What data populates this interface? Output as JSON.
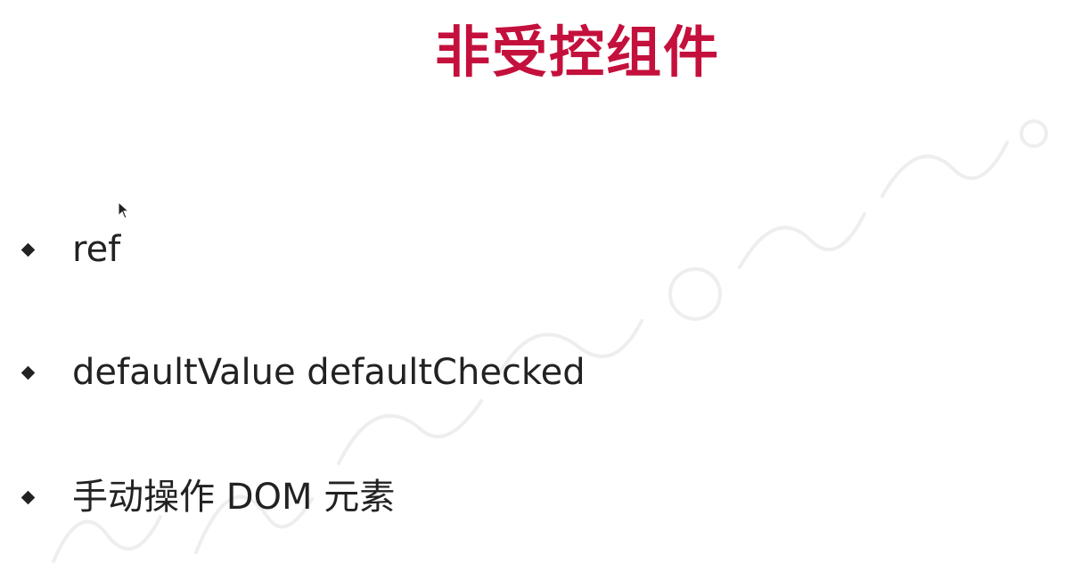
{
  "slide": {
    "title": "非受控组件",
    "bullets": [
      {
        "label": "ref"
      },
      {
        "label": "defaultValue defaultChecked"
      },
      {
        "label": "手动操作 DOM 元素"
      }
    ]
  },
  "colors": {
    "title": "#c4103c",
    "text": "#222222",
    "background": "#ffffff"
  }
}
